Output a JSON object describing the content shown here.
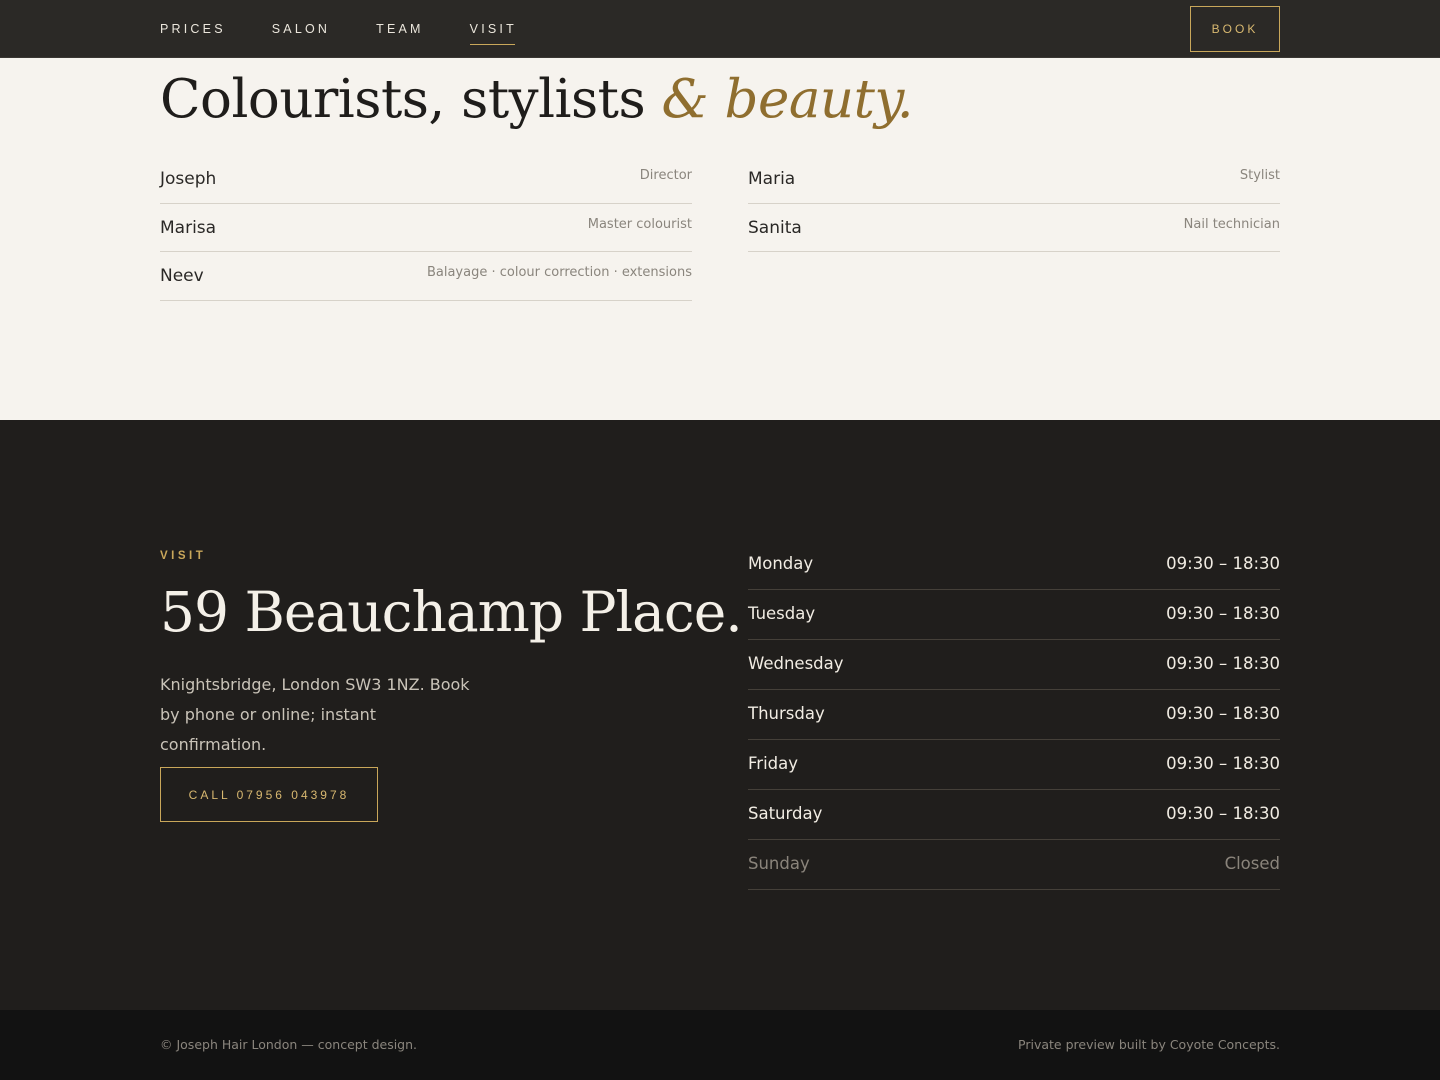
{
  "nav": {
    "links": [
      {
        "label": "PRICES",
        "active": false
      },
      {
        "label": "SALON",
        "active": false
      },
      {
        "label": "TEAM",
        "active": false
      },
      {
        "label": "VISIT",
        "active": true
      }
    ],
    "book_label": "BOOK"
  },
  "team": {
    "title_main": "Colourists, stylists ",
    "title_accent": "& beauty.",
    "left": [
      {
        "name": "Joseph",
        "role": "Director"
      },
      {
        "name": "Marisa",
        "role": "Master colourist"
      },
      {
        "name": "Neev",
        "role": "Balayage · colour correction · extensions"
      }
    ],
    "right": [
      {
        "name": "Maria",
        "role": "Stylist"
      },
      {
        "name": "Sanita",
        "role": "Nail technician"
      }
    ]
  },
  "visit": {
    "eyebrow": "VISIT",
    "title": "59 Beauchamp Place.",
    "description": "Knightsbridge, London SW3 1NZ. Book by phone or online; instant confirmation.",
    "call_label": "CALL 07956 043978",
    "hours": [
      {
        "day": "Monday",
        "time": "09:30 – 18:30",
        "closed": false
      },
      {
        "day": "Tuesday",
        "time": "09:30 – 18:30",
        "closed": false
      },
      {
        "day": "Wednesday",
        "time": "09:30 – 18:30",
        "closed": false
      },
      {
        "day": "Thursday",
        "time": "09:30 – 18:30",
        "closed": false
      },
      {
        "day": "Friday",
        "time": "09:30 – 18:30",
        "closed": false
      },
      {
        "day": "Saturday",
        "time": "09:30 – 18:30",
        "closed": false
      },
      {
        "day": "Sunday",
        "time": "Closed",
        "closed": true
      }
    ]
  },
  "footer": {
    "left": "© Joseph Hair London — concept design.",
    "right": "Private preview built by Coyote Concepts."
  },
  "colors": {
    "accent": "#c9a75a",
    "dark_bg": "#201e1c",
    "light_bg": "#f6f3ee"
  }
}
